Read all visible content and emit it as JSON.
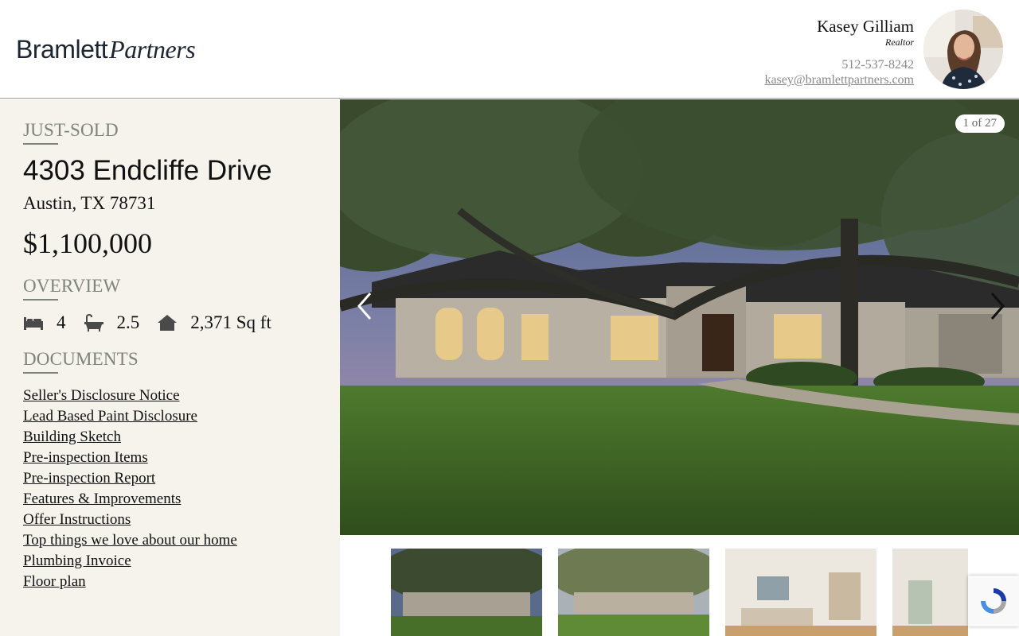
{
  "header": {
    "logo_part1": "Bramlett",
    "logo_part2": "Partners",
    "agent_name": "Kasey Gilliam",
    "agent_role": "Realtor",
    "agent_phone": "512-537-8242",
    "agent_email": "kasey@bramlettpartners.com"
  },
  "listing": {
    "status": "JUST-SOLD",
    "address": "4303 Endcliffe Drive",
    "city": "Austin, TX 78731",
    "price": "$1,100,000"
  },
  "overview": {
    "heading": "OVERVIEW",
    "beds": "4",
    "baths": "2.5",
    "sqft": "2,371 Sq ft",
    "icons": [
      "bed-icon",
      "bath-icon",
      "home-icon"
    ]
  },
  "documents": {
    "heading": "DOCUMENTS",
    "items": [
      "Seller's Disclosure Notice",
      "Lead Based Paint Disclosure",
      "Building Sketch",
      "Pre-inspection Items",
      "Pre-inspection Report",
      "Features & Improvements",
      "Offer Instructions",
      "Top things we love about our home",
      "Plumbing Invoice",
      "Floor plan"
    ]
  },
  "gallery": {
    "counter": "1 of 27"
  },
  "colors": {
    "sidebar_bg": "#f5f3ec",
    "accent_gray_green": "#7d8579",
    "logo_navy": "#1c2530"
  }
}
